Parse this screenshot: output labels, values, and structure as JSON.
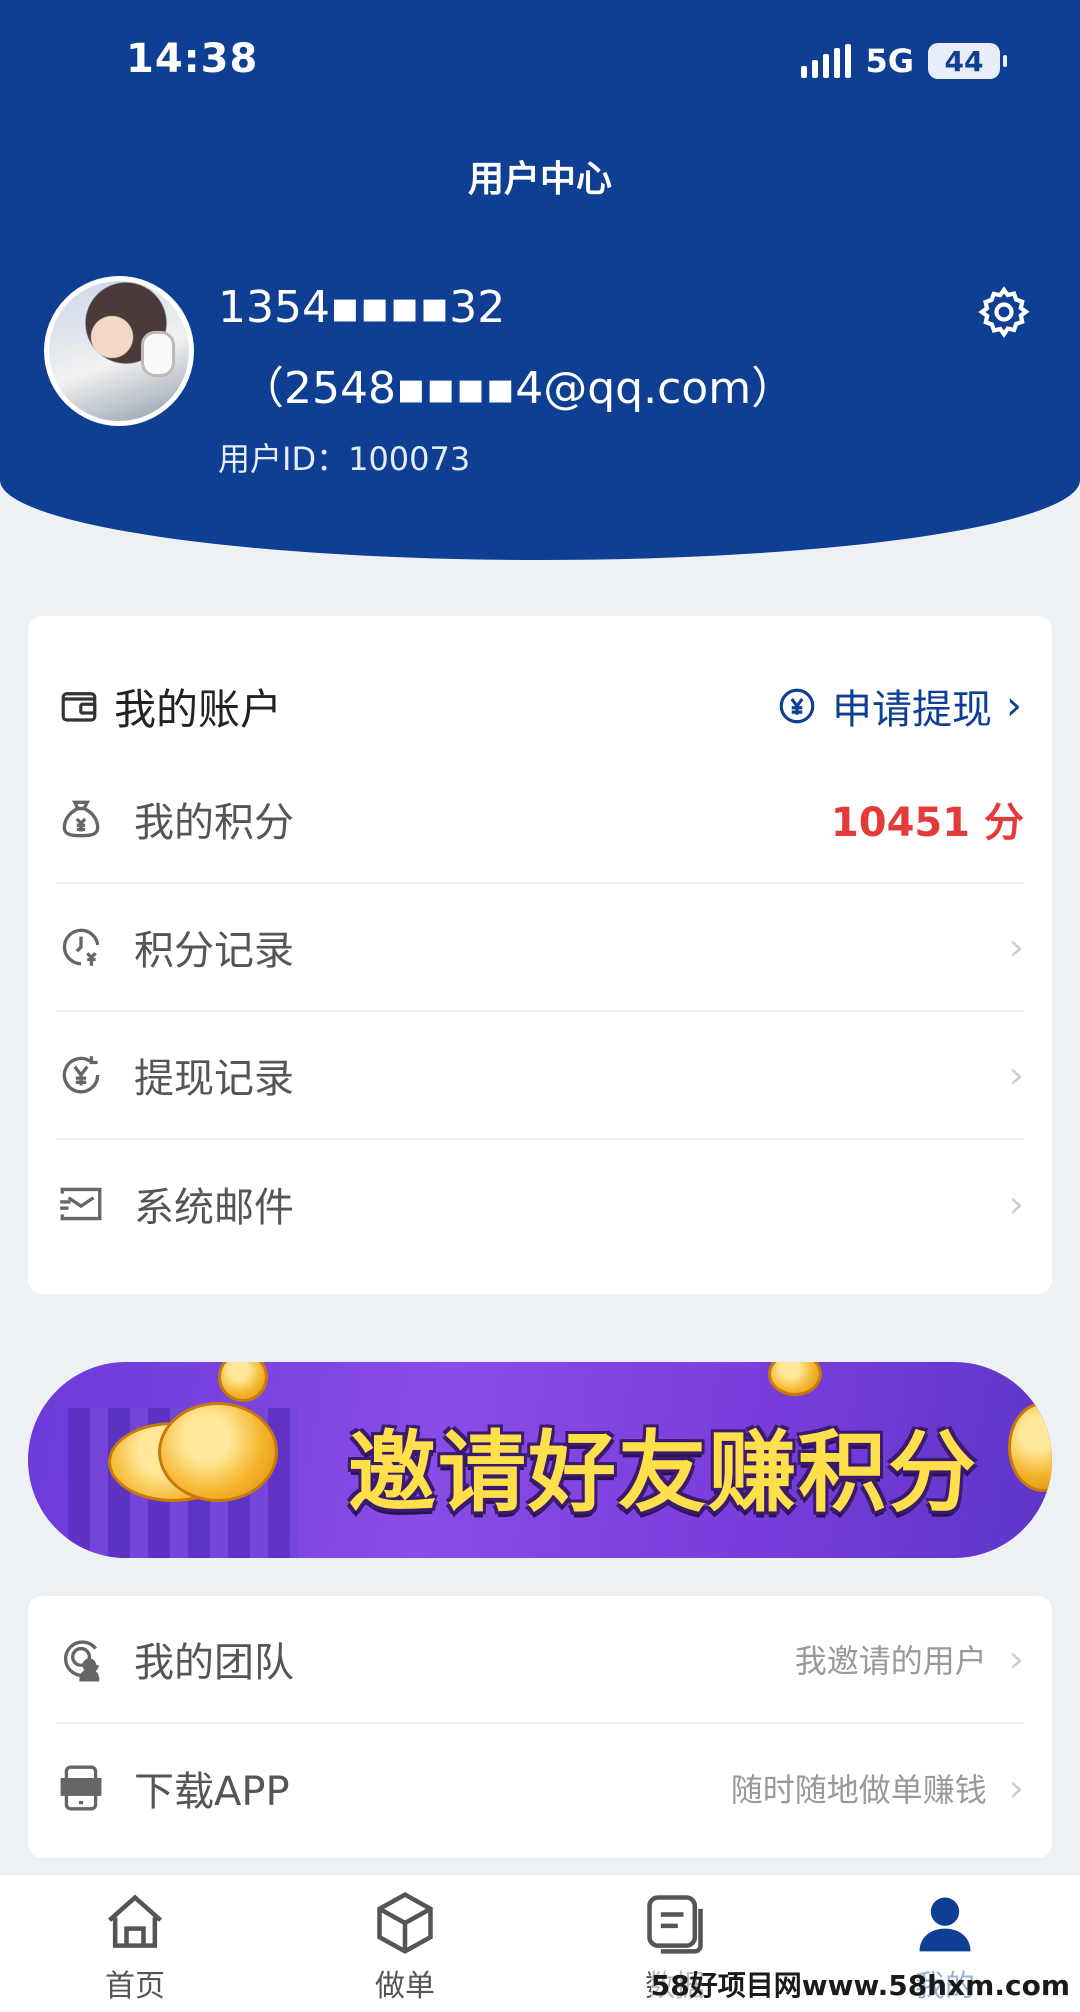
{
  "status_bar": {
    "time": "14:38",
    "network": "5G",
    "battery": "44"
  },
  "header": {
    "title": "用户中心",
    "phone": "1354▪▪▪▪32",
    "email": "（2548▪▪▪▪4@qq.com）",
    "user_id_label": "用户ID：100073"
  },
  "account": {
    "title": "我的账户",
    "withdraw_label": "申请提现",
    "rows": [
      {
        "label": "我的积分",
        "value": "10451 分",
        "icon": "money-bag-icon"
      },
      {
        "label": "积分记录",
        "icon": "clock-yuan-icon"
      },
      {
        "label": "提现记录",
        "icon": "yuan-cycle-icon"
      },
      {
        "label": "系统邮件",
        "icon": "mail-icon"
      }
    ]
  },
  "banner": {
    "text": "邀请好友赚积分"
  },
  "more": {
    "rows": [
      {
        "label": "我的团队",
        "sub": "我邀请的用户",
        "icon": "team-icon"
      },
      {
        "label": "下载APP",
        "sub": "随时随地做单赚钱",
        "icon": "app-download-icon"
      }
    ]
  },
  "bottom_nav": {
    "items": [
      {
        "label": "首页",
        "icon": "home-icon"
      },
      {
        "label": "做单",
        "icon": "box-icon"
      },
      {
        "label": "数据",
        "icon": "data-icon"
      },
      {
        "label": "我的",
        "icon": "profile-icon",
        "active": true
      }
    ]
  },
  "watermark": "58好项目网www.58hxm.com",
  "colors": {
    "brand": "#0f3f92",
    "points": "#e43a3a",
    "banner_text": "#ffe04a"
  }
}
